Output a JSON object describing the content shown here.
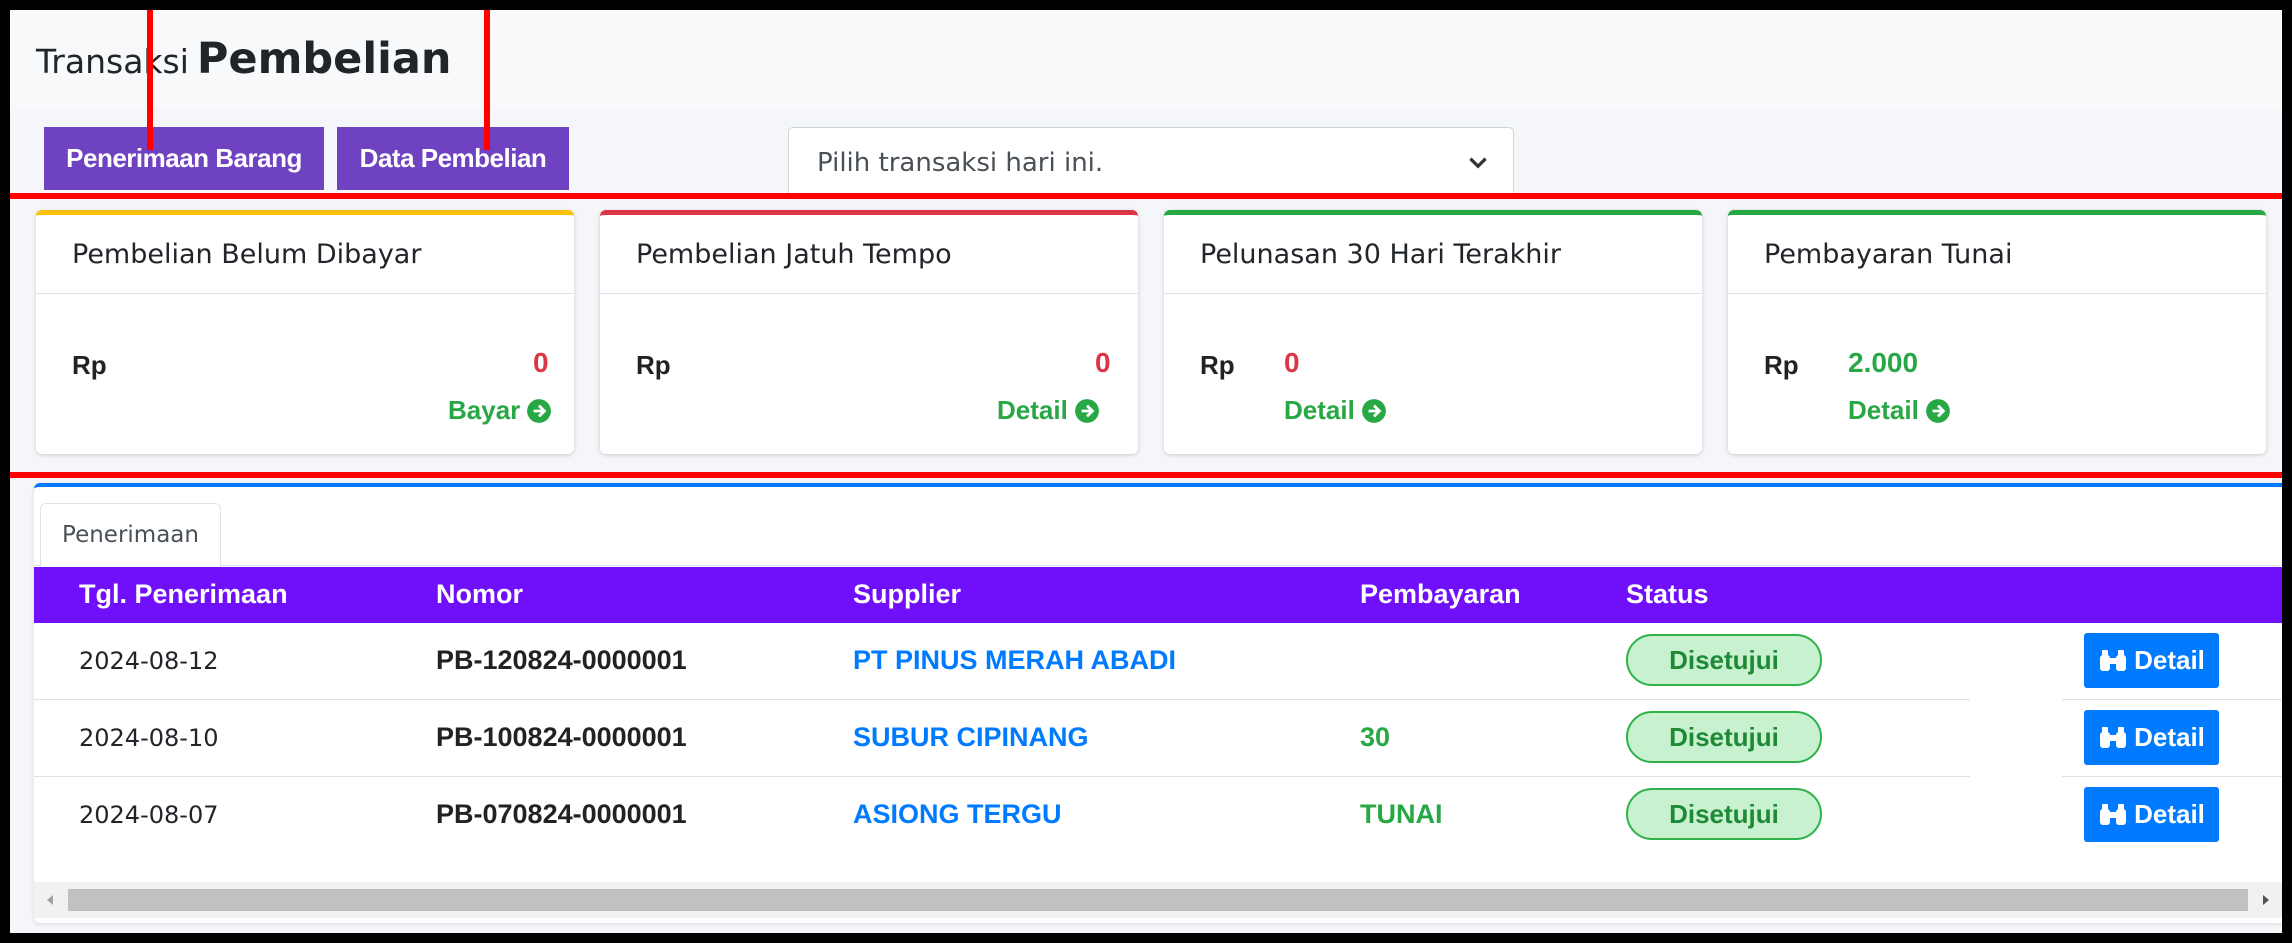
{
  "header": {
    "title_small": "Transaksi",
    "title_big": "Pembelian"
  },
  "toolbar": {
    "penerimaan_label": "Penerimaan Barang",
    "data_pembelian_label": "Data Pembelian",
    "select_value": "Pilih transaksi hari ini."
  },
  "cards": [
    {
      "title": "Pembelian Belum Dibayar",
      "currency": "Rp",
      "value": "0",
      "link": "Bayar",
      "color": "#ffc107",
      "value_color": "#dc3545"
    },
    {
      "title": "Pembelian Jatuh Tempo",
      "currency": "Rp",
      "value": "0",
      "link": "Detail",
      "color": "#dc3545",
      "value_color": "#dc3545"
    },
    {
      "title": "Pelunasan 30 Hari Terakhir",
      "currency": "Rp",
      "value": "0",
      "link": "Detail",
      "color": "#28a745",
      "value_color": "#dc3545"
    },
    {
      "title": "Pembayaran Tunai",
      "currency": "Rp",
      "value": "2.000",
      "link": "Detail",
      "color": "#28a745",
      "value_color": "#28a745"
    }
  ],
  "panel": {
    "tab_label": "Penerimaan",
    "columns": [
      "Tgl. Penerimaan",
      "Nomor",
      "Supplier",
      "Pembayaran",
      "Status"
    ],
    "rows": [
      {
        "date": "2024-08-12",
        "nomor": "PB-120824-0000001",
        "supplier": "PT PINUS MERAH ABADI",
        "pembayaran": "",
        "status": "Disetujui",
        "action": "Detail"
      },
      {
        "date": "2024-08-10",
        "nomor": "PB-100824-0000001",
        "supplier": "SUBUR CIPINANG",
        "pembayaran": "30",
        "status": "Disetujui",
        "action": "Detail"
      },
      {
        "date": "2024-08-07",
        "nomor": "PB-070824-0000001",
        "supplier": "ASIONG TERGU",
        "pembayaran": "TUNAI",
        "status": "Disetujui",
        "action": "Detail"
      }
    ]
  },
  "colors": {
    "primary_purple": "#6f42c1",
    "table_header": "#7010fa",
    "link_blue": "#007bff",
    "success": "#28a745",
    "danger": "#dc3545",
    "annotation_red": "#ff0000"
  }
}
